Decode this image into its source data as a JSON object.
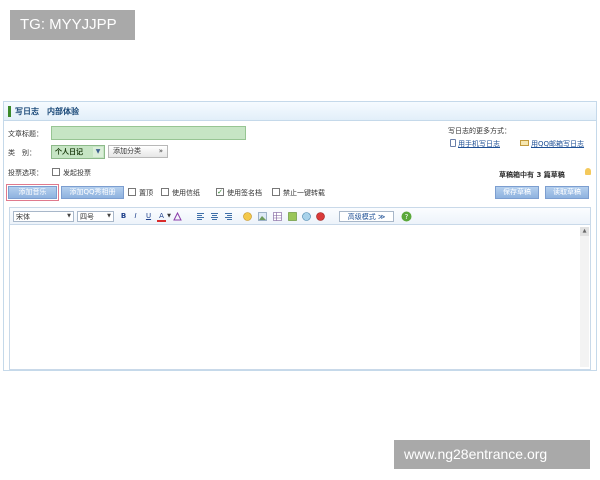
{
  "watermarks": {
    "top": "TG: MYYJJPP",
    "bottom": "www.ng28entrance.org"
  },
  "header": {
    "title": "写日志",
    "subtitle": "内部体验"
  },
  "form": {
    "title_label": "文章标题：",
    "category_label": "类　别：",
    "category_value": "个人日记",
    "add_category": "添加分类",
    "vote_label": "投票选项：",
    "vote_checkbox": "发起投票"
  },
  "more_ways": {
    "label": "写日志的更多方式：",
    "phone_link": "用手机写日志",
    "mail_link": "用QQ邮箱写日志"
  },
  "drafts": {
    "prefix": "草稿箱中有",
    "count": "3",
    "suffix": "篇草稿"
  },
  "actions": {
    "add_music": "添加音乐",
    "add_qq_album": "添加QQ秀相册",
    "top": "置顶",
    "use_stationery": "使用信纸",
    "use_signature": "使用签名档",
    "forbid_repost": "禁止一键转载",
    "save_draft": "保存草稿",
    "read_draft": "读取草稿"
  },
  "toolbar": {
    "font": "宋体",
    "size": "四号",
    "bold": "B",
    "italic": "I",
    "underline": "U",
    "color": "A",
    "advanced": "高级模式 ≫"
  },
  "colors": {
    "accent": "#1d4b7a",
    "input_bg": "#c6e5c4",
    "button_blue": "#9dbde5",
    "watermark": "#a9a9a9"
  },
  "checks": {
    "top": false,
    "use_stationery": false,
    "use_signature": true,
    "forbid_repost": false,
    "vote": false
  },
  "icons": [
    "align-left-icon",
    "align-center-icon",
    "align-right-icon",
    "emoticon-icon",
    "image-icon",
    "table-icon",
    "flash-icon",
    "video-icon",
    "music-icon",
    "help-icon"
  ]
}
